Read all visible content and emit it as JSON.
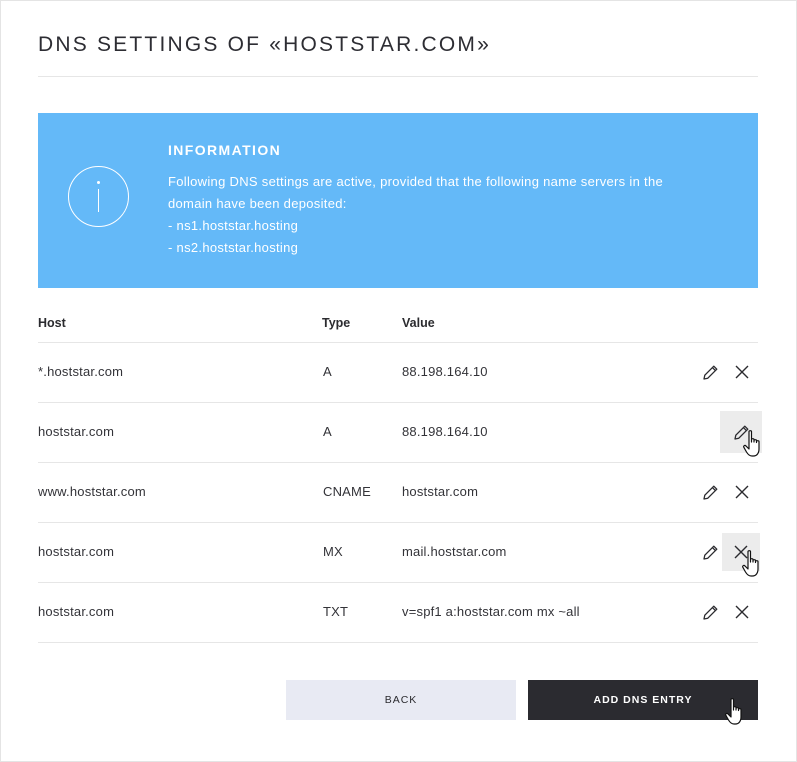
{
  "page": {
    "title": "DNS SETTINGS OF «HOSTSTAR.COM»"
  },
  "info": {
    "heading": "INFORMATION",
    "line1": "Following DNS settings are active, provided that the following name servers in the",
    "line2": "domain have been deposited:",
    "ns1": "- ns1.hoststar.hosting",
    "ns2": "- ns2.hoststar.hosting",
    "icon": "info-circle-icon"
  },
  "table": {
    "headers": {
      "host": "Host",
      "type": "Type",
      "value": "Value"
    },
    "rows": [
      {
        "host": "*.hoststar.com",
        "type": "A",
        "value": "88.198.164.10"
      },
      {
        "host": "hoststar.com",
        "type": "A",
        "value": "88.198.164.10"
      },
      {
        "host": "www.hoststar.com",
        "type": "CNAME",
        "value": "hoststar.com"
      },
      {
        "host": "hoststar.com",
        "type": "MX",
        "value": "mail.hoststar.com"
      },
      {
        "host": "hoststar.com",
        "type": "TXT",
        "value": "v=spf1 a:hoststar.com mx ~all"
      }
    ],
    "row_icons": {
      "edit": "pencil-icon",
      "delete": "close-icon"
    }
  },
  "actions": {
    "back_label": "BACK",
    "add_label": "ADD DNS ENTRY"
  },
  "colors": {
    "info_background": "#64b9f8",
    "primary_button": "#2b2b30",
    "secondary_button": "#e8eaf3",
    "hover_background": "#ececec"
  }
}
